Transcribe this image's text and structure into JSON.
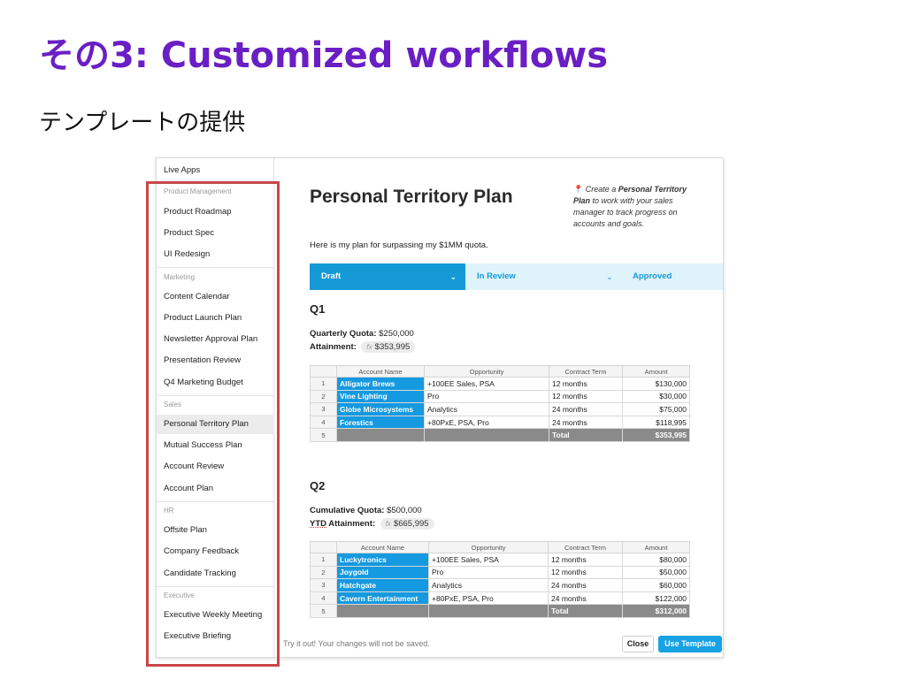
{
  "slide": {
    "title": "その3: Customized workflows",
    "subtitle": "テンプレートの提供"
  },
  "sidebar": {
    "live_apps": "Live Apps",
    "sections": [
      {
        "label": "Product Management",
        "items": [
          "Product Roadmap",
          "Product Spec",
          "UI Redesign"
        ]
      },
      {
        "label": "Marketing",
        "items": [
          "Content Calendar",
          "Product Launch Plan",
          "Newsletter Approval Plan",
          "Presentation Review",
          "Q4 Marketing Budget"
        ]
      },
      {
        "label": "Sales",
        "items": [
          "Personal Territory Plan",
          "Mutual Success Plan",
          "Account Review",
          "Account Plan"
        ]
      },
      {
        "label": "HR",
        "items": [
          "Offsite Plan",
          "Company Feedback",
          "Candidate Tracking"
        ]
      },
      {
        "label": "Executive",
        "items": [
          "Executive Weekly Meeting",
          "Executive Briefing"
        ]
      }
    ]
  },
  "doc": {
    "title": "Personal Territory Plan",
    "hint_prefix": "Create a ",
    "hint_bold": "Personal Territory Plan",
    "hint_suffix": " to work with your sales manager to track progress on accounts and goals.",
    "intro": "Here is my plan for surpassing my $1MM quota.",
    "status": {
      "draft": "Draft",
      "review": "In Review",
      "approved": "Approved"
    }
  },
  "q1": {
    "heading": "Q1",
    "quota_label": "Quarterly Quota:",
    "quota_value": "$250,000",
    "attain_label": "Attainment:",
    "attain_value": "$353,995",
    "columns": [
      "Account Name",
      "Opportunity",
      "Contract Term",
      "Amount"
    ],
    "rows": [
      {
        "n": "1",
        "account": "Alligator Brews",
        "opp": "+100EE Sales, PSA",
        "term": "12 months",
        "amount": "$130,000"
      },
      {
        "n": "2",
        "account": "Vine Lighting",
        "opp": "Pro",
        "term": "12 months",
        "amount": "$30,000"
      },
      {
        "n": "3",
        "account": "Globe Microsystems",
        "opp": "Analytics",
        "term": "24 months",
        "amount": "$75,000"
      },
      {
        "n": "4",
        "account": "Forestics",
        "opp": "+80PxE, PSA, Pro",
        "term": "24 months",
        "amount": "$118,995"
      }
    ],
    "total_n": "5",
    "total_label": "Total",
    "total_value": "$353,995"
  },
  "q2": {
    "heading": "Q2",
    "quota_label": "Cumulative Quota:",
    "quota_value": "$500,000",
    "attain_label_u": "YTD",
    "attain_label": " Attainment:",
    "attain_value": "$665,995",
    "columns": [
      "Account Name",
      "Opportunity",
      "Contract Term",
      "Amount"
    ],
    "rows": [
      {
        "n": "1",
        "account": "Luckytronics",
        "opp": "+100EE Sales, PSA",
        "term": "12 months",
        "amount": "$80,000"
      },
      {
        "n": "2",
        "account": "Joygold",
        "opp": "Pro",
        "term": "12 months",
        "amount": "$50,000"
      },
      {
        "n": "3",
        "account": "Hatchgate",
        "opp": "Analytics",
        "term": "24 months",
        "amount": "$60,000"
      },
      {
        "n": "4",
        "account": "Cavern Entertainment",
        "opp": "+80PxE, PSA, Pro",
        "term": "24 months",
        "amount": "$122,000"
      }
    ],
    "total_n": "5",
    "total_label": "Total",
    "total_value": "$312,000"
  },
  "footer": {
    "note": "Try it out! Your changes will not be saved.",
    "close": "Close",
    "use_template": "Use Template"
  },
  "icons": {
    "pin": "map-pin-icon",
    "chevron": "chevron-down-icon",
    "fx": "formula-icon"
  },
  "colors": {
    "title": "#6a1fc4",
    "accent": "#1599d6",
    "highlight": "#c8474a"
  }
}
